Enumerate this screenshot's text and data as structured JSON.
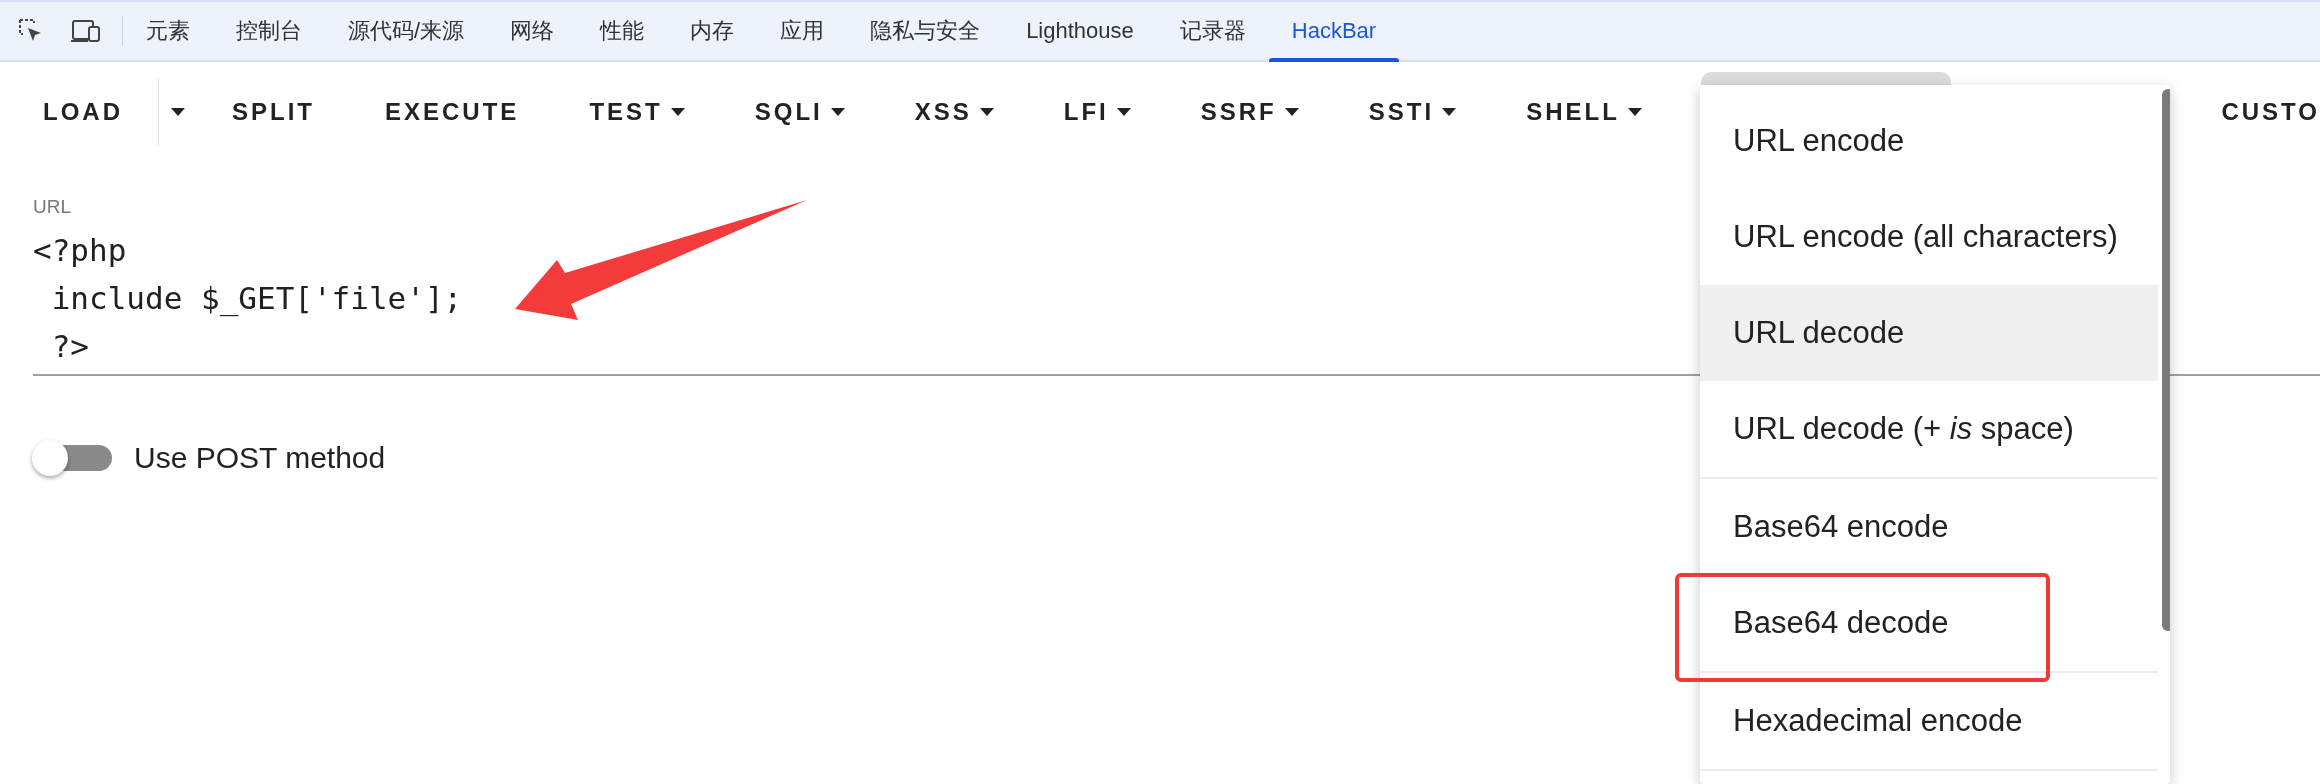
{
  "devtools_tabs": [
    {
      "label": "元素",
      "selected": false
    },
    {
      "label": "控制台",
      "selected": false
    },
    {
      "label": "源代码/来源",
      "selected": false
    },
    {
      "label": "网络",
      "selected": false
    },
    {
      "label": "性能",
      "selected": false
    },
    {
      "label": "内存",
      "selected": false
    },
    {
      "label": "应用",
      "selected": false
    },
    {
      "label": "隐私与安全",
      "selected": false
    },
    {
      "label": "Lighthouse",
      "selected": false
    },
    {
      "label": "记录器",
      "selected": false
    },
    {
      "label": "HackBar",
      "selected": true
    }
  ],
  "toolbar": {
    "buttons": [
      {
        "label": "LOAD",
        "kind": "split"
      },
      {
        "label": "SPLIT",
        "kind": "plain"
      },
      {
        "label": "EXECUTE",
        "kind": "plain"
      },
      {
        "label": "TEST",
        "kind": "dropdown"
      },
      {
        "label": "SQLI",
        "kind": "dropdown"
      },
      {
        "label": "XSS",
        "kind": "dropdown"
      },
      {
        "label": "LFI",
        "kind": "dropdown"
      },
      {
        "label": "SSRF",
        "kind": "dropdown"
      },
      {
        "label": "SSTI",
        "kind": "dropdown"
      },
      {
        "label": "SHELL",
        "kind": "dropdown"
      },
      {
        "kind": "covered"
      },
      {
        "label": "CUSTO",
        "kind": "plain"
      }
    ]
  },
  "url": {
    "label": "URL",
    "value": "<?php\n include $_GET['file'];\n ?>"
  },
  "post_toggle": {
    "label": "Use POST method",
    "on": false
  },
  "menu": {
    "groups": [
      [
        {
          "label": "URL encode",
          "highlighted": false
        },
        {
          "label": "URL encode (all characters)",
          "highlighted": false
        },
        {
          "label": "URL decode",
          "highlighted": true
        },
        {
          "label": "URL decode (+ *is* space)",
          "highlighted": false
        }
      ],
      [
        {
          "label": "Base64 encode",
          "highlighted": false
        },
        {
          "label": "Base64 decode",
          "highlighted": false
        }
      ],
      [
        {
          "label": "Hexadecimal encode",
          "highlighted": false
        }
      ]
    ]
  }
}
